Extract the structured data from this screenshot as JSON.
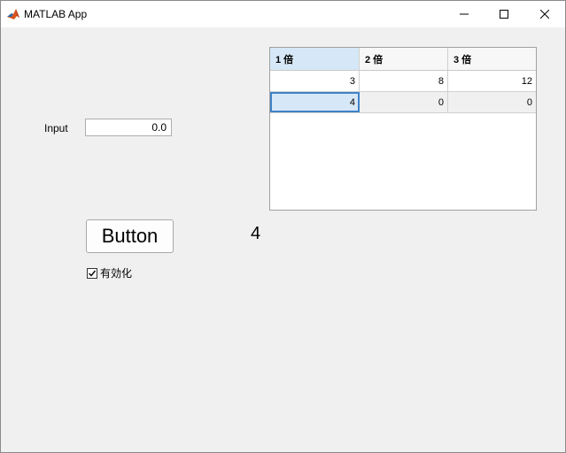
{
  "window": {
    "title": "MATLAB App",
    "icon": "matlab-logo-icon",
    "controls": [
      "minimize-icon",
      "maximize-icon",
      "close-icon"
    ]
  },
  "form": {
    "input_label": "Input",
    "input_value": "0.0",
    "button_label": "Button",
    "value_display": "4",
    "checkbox_label": "有効化",
    "checkbox_checked": true
  },
  "table": {
    "headers": [
      "1 倍",
      "2 倍",
      "3 倍"
    ],
    "rows": [
      [
        "3",
        "8",
        "12"
      ],
      [
        "4",
        "0",
        "0"
      ]
    ],
    "selected_cell": {
      "row": 1,
      "col": 0
    }
  },
  "colors": {
    "window_bg": "#f0f0f0",
    "selection": "#d6e8f7",
    "focus_border": "#3f82c6"
  }
}
